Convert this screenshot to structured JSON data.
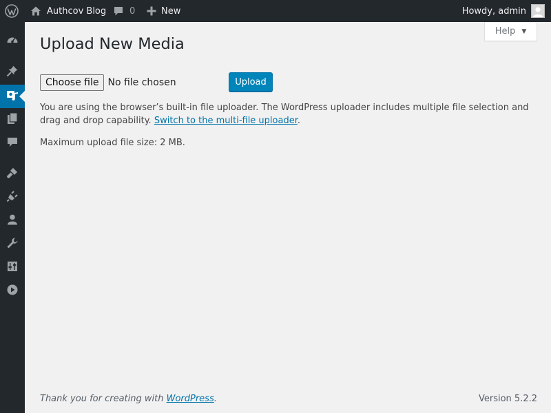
{
  "adminbar": {
    "site_name": "Authcov Blog",
    "comments_count": "0",
    "new_label": "New",
    "howdy": "Howdy, admin"
  },
  "sidebar": {
    "items": [
      {
        "icon": "dashboard-icon"
      },
      {
        "icon": "posts-pin-icon"
      },
      {
        "icon": "media-icon",
        "current": true
      },
      {
        "icon": "pages-icon"
      },
      {
        "icon": "comments-icon"
      },
      {
        "icon": "appearance-brush-icon"
      },
      {
        "icon": "plugins-icon"
      },
      {
        "icon": "users-icon"
      },
      {
        "icon": "tools-wrench-icon"
      },
      {
        "icon": "settings-sliders-icon"
      },
      {
        "icon": "collapse-play-icon"
      }
    ]
  },
  "help_tab": {
    "label": "Help"
  },
  "page": {
    "title": "Upload New Media",
    "choose_file_label": "Choose file",
    "no_file_text": "No file chosen",
    "upload_label": "Upload",
    "info_text": "You are using the browser’s built-in file uploader. The WordPress uploader includes multiple file selection and drag and drop capability.",
    "switch_link": "Switch to the multi-file uploader",
    "info_suffix": ".",
    "max_size": "Maximum upload file size: 2 MB."
  },
  "footer": {
    "thanks_prefix": "Thank you for creating with",
    "wordpress_link": "WordPress",
    "thanks_suffix": ".",
    "version": "Version 5.2.2"
  },
  "colors": {
    "adminbar_bg": "#23282d",
    "accent": "#0073aa",
    "button_primary": "#0085ba",
    "page_bg": "#f1f1f1"
  }
}
